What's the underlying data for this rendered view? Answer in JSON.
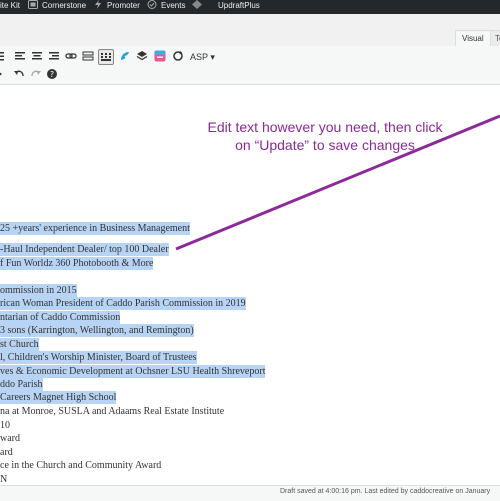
{
  "adminbar": {
    "items": [
      {
        "label": "ite Kit",
        "icon": "none"
      },
      {
        "label": "Cornerstone",
        "icon": "cornerstone-icon"
      },
      {
        "label": "Promoter",
        "icon": "bolt-icon"
      },
      {
        "label": "Events",
        "icon": "events-icon"
      },
      {
        "label": "UpdraftPlus",
        "icon": "updraft-icon"
      }
    ]
  },
  "tabs": {
    "visual": "Visual",
    "text": "Te"
  },
  "toolbar": {
    "row1": [
      "list-icon",
      "align-left-icon",
      "align-center-icon",
      "align-right-icon",
      "link-icon",
      "read-more-icon",
      "toolbar-toggle-icon",
      "fusion-icon",
      "layers-icon",
      "shortcode-icon",
      "refresh-icon"
    ],
    "asp_label": "ASP ▾",
    "row2": [
      "indent-icon",
      "undo-icon",
      "redo-icon",
      "help-icon"
    ]
  },
  "annotation": {
    "line1": "Edit text however you need, then click",
    "line2": "on “Update” to save changes",
    "color": "#8b2a98"
  },
  "content": {
    "lines": [
      "25 +years' experience in Business Management",
      "-Haul Independent Dealer/ top 100 Dealer",
      "f Fun Worldz 360 Photobooth & More",
      "",
      "ommission in 2015",
      "rican Woman President of Caddo Parish Commission in 2019",
      "ntarian of Caddo Commission",
      "3 sons (Karrington, Wellington, and Remington)",
      "st Church",
      "l, Children's Worship Minister, Board of Trustees",
      "ves & Economic Development at Ochsner LSU Health Shreveport",
      "ddo Parish",
      "Careers Magnet High School",
      "na at Monroe, SUSLA and Adaams Real Estate Institute",
      "10",
      "ward",
      "ard",
      "ce in the Church and Community Award",
      "N"
    ]
  },
  "status": {
    "text": "Draft saved at 4:00:16 pm. Last edited by caddocreative on January"
  }
}
